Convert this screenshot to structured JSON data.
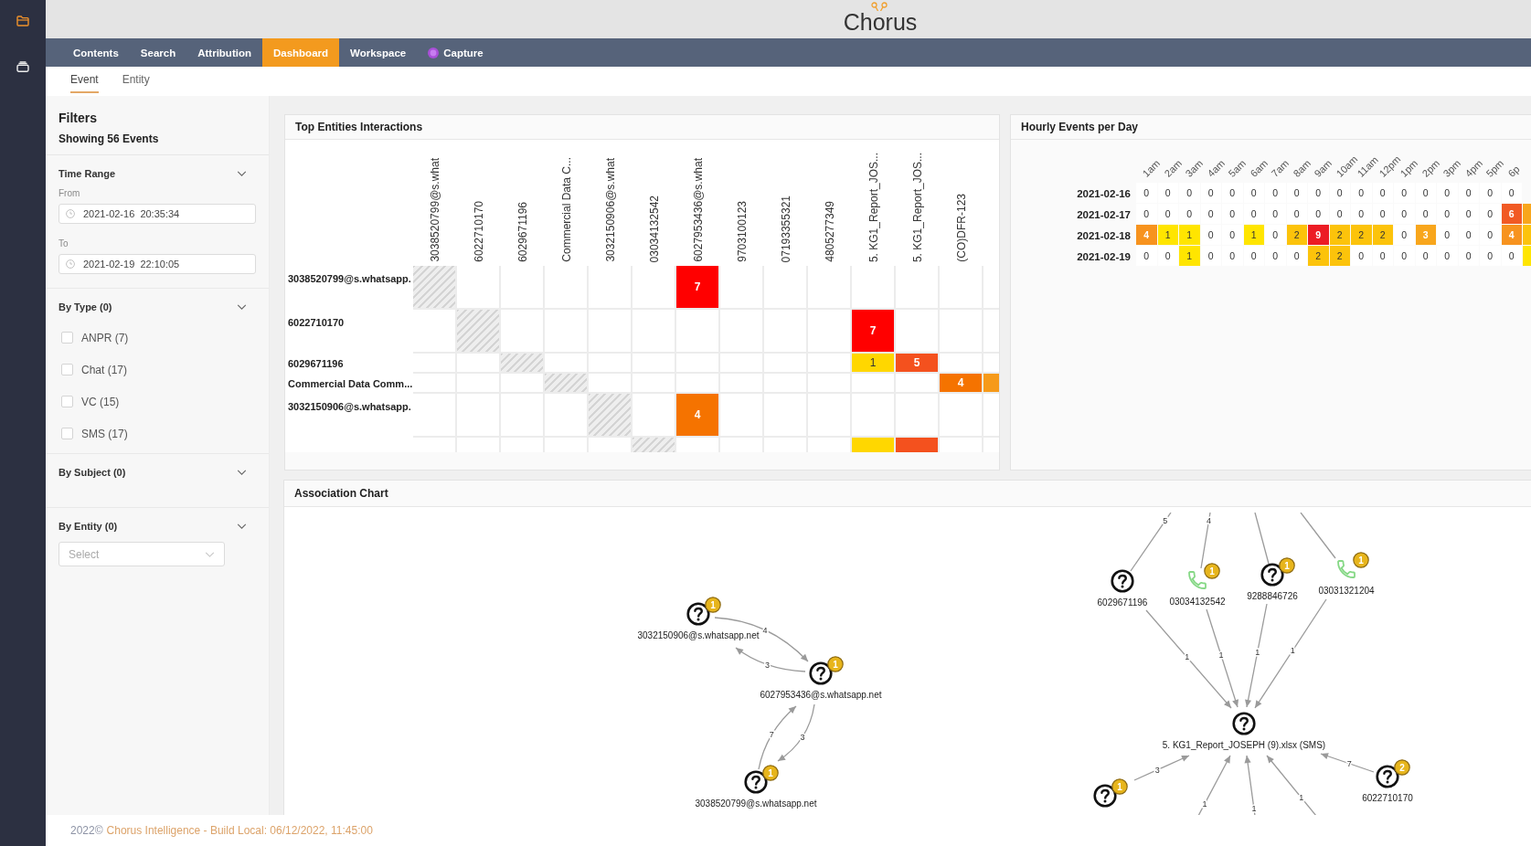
{
  "sidebar": {
    "items": [
      {
        "selected": true
      },
      {
        "selected": false
      }
    ]
  },
  "header": {
    "logo": "Chorus"
  },
  "nav": {
    "items": [
      {
        "label": "Contents",
        "kind": "plain",
        "selected": false
      },
      {
        "label": "Search",
        "kind": "plain",
        "selected": false
      },
      {
        "label": "Attribution",
        "kind": "plain",
        "selected": false
      },
      {
        "label": "Dashboard",
        "kind": "plain",
        "selected": true
      },
      {
        "label": "Workspace",
        "kind": "plain",
        "selected": false
      },
      {
        "label": "Capture",
        "kind": "icon",
        "selected": false
      }
    ]
  },
  "subtabs": [
    {
      "label": "Event",
      "selected": true
    },
    {
      "label": "Entity",
      "selected": false
    }
  ],
  "filters": {
    "title": "Filters",
    "summary": "Showing 56 Events",
    "sections": [
      {
        "kind": "time",
        "title": "Time Range",
        "from_label": "From",
        "from_value": "2021-02-16  20:35:34",
        "to_label": "To",
        "to_value": "2021-02-19  22:10:05"
      },
      {
        "kind": "checklist",
        "title": "By Type (0)",
        "options": [
          {
            "label": "ANPR (7)",
            "checked": false
          },
          {
            "label": "Chat (17)",
            "checked": false
          },
          {
            "label": "VC (15)",
            "checked": false
          },
          {
            "label": "SMS (17)",
            "checked": false
          }
        ]
      },
      {
        "kind": "empty",
        "title": "By Subject (0)"
      },
      {
        "kind": "select",
        "title": "By Entity (0)",
        "placeholder": "Select"
      }
    ]
  },
  "top_entities": {
    "title": "Top Entities Interactions",
    "columns": [
      "3038520799@s.what",
      "6022710170",
      "6029671196",
      "Commercial Data C...",
      "3032150906@s.what",
      "03034132542",
      "6027953436@s.what",
      "9703100123",
      "07193355321",
      "4805277349",
      "5. KG1_Report_JOS...",
      "5. KG1_Report_JOS...",
      "(CO)DFR-123"
    ],
    "rows": [
      {
        "label": "3038520799@s.whatsapp.",
        "kind": "tall",
        "cells": [
          {
            "kind": "self"
          },
          {
            "kind": "blank"
          },
          {
            "kind": "blank"
          },
          {
            "kind": "blank"
          },
          {
            "kind": "blank"
          },
          {
            "kind": "blank"
          },
          {
            "kind": "count",
            "value": "7",
            "color": "#ff0000"
          },
          {
            "kind": "blank"
          },
          {
            "kind": "blank"
          },
          {
            "kind": "blank"
          },
          {
            "kind": "blank"
          },
          {
            "kind": "blank"
          },
          {
            "kind": "blank"
          },
          {
            "kind": "blank"
          }
        ]
      },
      {
        "label": "6022710170",
        "kind": "tall",
        "cells": [
          {
            "kind": "blank"
          },
          {
            "kind": "self"
          },
          {
            "kind": "blank"
          },
          {
            "kind": "blank"
          },
          {
            "kind": "blank"
          },
          {
            "kind": "blank"
          },
          {
            "kind": "blank"
          },
          {
            "kind": "blank"
          },
          {
            "kind": "blank"
          },
          {
            "kind": "blank"
          },
          {
            "kind": "count",
            "value": "7",
            "color": "#ff0000"
          },
          {
            "kind": "blank"
          },
          {
            "kind": "blank"
          },
          {
            "kind": "blank"
          }
        ]
      },
      {
        "label": "6029671196",
        "kind": "short",
        "cells": [
          {
            "kind": "blank"
          },
          {
            "kind": "blank"
          },
          {
            "kind": "self"
          },
          {
            "kind": "blank"
          },
          {
            "kind": "blank"
          },
          {
            "kind": "blank"
          },
          {
            "kind": "blank"
          },
          {
            "kind": "blank"
          },
          {
            "kind": "blank"
          },
          {
            "kind": "blank"
          },
          {
            "kind": "count",
            "value": "1",
            "color": "#ffd700"
          },
          {
            "kind": "count",
            "value": "5",
            "color": "#f4511e"
          },
          {
            "kind": "blank"
          },
          {
            "kind": "blank"
          }
        ]
      },
      {
        "label": "Commercial Data Comm...",
        "kind": "short",
        "cells": [
          {
            "kind": "blank"
          },
          {
            "kind": "blank"
          },
          {
            "kind": "blank"
          },
          {
            "kind": "self"
          },
          {
            "kind": "blank"
          },
          {
            "kind": "blank"
          },
          {
            "kind": "blank"
          },
          {
            "kind": "blank"
          },
          {
            "kind": "blank"
          },
          {
            "kind": "blank"
          },
          {
            "kind": "blank"
          },
          {
            "kind": "blank"
          },
          {
            "kind": "count",
            "value": "4",
            "color": "#f57300"
          },
          {
            "kind": "count",
            "color": "#f69a1a"
          }
        ]
      },
      {
        "label": "3032150906@s.whatsapp.",
        "kind": "tall",
        "cells": [
          {
            "kind": "blank"
          },
          {
            "kind": "blank"
          },
          {
            "kind": "blank"
          },
          {
            "kind": "blank"
          },
          {
            "kind": "self"
          },
          {
            "kind": "blank"
          },
          {
            "kind": "count",
            "value": "4",
            "color": "#f57300"
          },
          {
            "kind": "blank"
          },
          {
            "kind": "blank"
          },
          {
            "kind": "blank"
          },
          {
            "kind": "blank"
          },
          {
            "kind": "blank"
          },
          {
            "kind": "blank"
          },
          {
            "kind": "blank"
          }
        ]
      },
      {
        "kind": "tall",
        "cells": [
          {
            "kind": "blank"
          },
          {
            "kind": "blank"
          },
          {
            "kind": "blank"
          },
          {
            "kind": "blank"
          },
          {
            "kind": "blank"
          },
          {
            "kind": "self"
          },
          {
            "kind": "blank"
          },
          {
            "kind": "blank"
          },
          {
            "kind": "blank"
          },
          {
            "kind": "blank"
          },
          {
            "kind": "count",
            "color": "#ffd700"
          },
          {
            "kind": "count",
            "color": "#f4511e"
          },
          {
            "kind": "blank"
          },
          {
            "kind": "blank"
          }
        ]
      }
    ]
  },
  "hourly_events": {
    "title": "Hourly Events per Day",
    "columns": [
      "1am",
      "2am",
      "3am",
      "4am",
      "5am",
      "6am",
      "7am",
      "8am",
      "9am",
      "10am",
      "11am",
      "12pm",
      "1pm",
      "2pm",
      "3pm",
      "4pm",
      "5pm",
      "6p"
    ],
    "rows": [
      {
        "date": "2021-02-16",
        "cells": [
          {
            "value": "0"
          },
          {
            "value": "0"
          },
          {
            "value": "0"
          },
          {
            "value": "0"
          },
          {
            "value": "0"
          },
          {
            "value": "0"
          },
          {
            "value": "0"
          },
          {
            "value": "0"
          },
          {
            "value": "0"
          },
          {
            "value": "0"
          },
          {
            "value": "0"
          },
          {
            "value": "0"
          },
          {
            "value": "0"
          },
          {
            "value": "0"
          },
          {
            "value": "0"
          },
          {
            "value": "0"
          },
          {
            "value": "0"
          },
          {
            "value": "0"
          }
        ]
      },
      {
        "date": "2021-02-17",
        "cells": [
          {
            "value": "0"
          },
          {
            "value": "0"
          },
          {
            "value": "0"
          },
          {
            "value": "0"
          },
          {
            "value": "0"
          },
          {
            "value": "0"
          },
          {
            "value": "0"
          },
          {
            "value": "0"
          },
          {
            "value": "0"
          },
          {
            "value": "0"
          },
          {
            "value": "0"
          },
          {
            "value": "0"
          },
          {
            "value": "0"
          },
          {
            "value": "0"
          },
          {
            "value": "0"
          },
          {
            "value": "0"
          },
          {
            "value": "0"
          },
          {
            "value": "6",
            "color": "#f15a24"
          },
          {
            "color": "#f8a61c"
          }
        ]
      },
      {
        "date": "2021-02-18",
        "cells": [
          {
            "value": "4",
            "color": "#f7931e"
          },
          {
            "value": "1",
            "color": "#ffe500"
          },
          {
            "value": "1",
            "color": "#ffe500"
          },
          {
            "value": "0"
          },
          {
            "value": "0"
          },
          {
            "value": "1",
            "color": "#ffe500"
          },
          {
            "value": "0"
          },
          {
            "value": "2",
            "color": "#fcc30b"
          },
          {
            "value": "9",
            "color": "#ec1c24"
          },
          {
            "value": "2",
            "color": "#fcc30b"
          },
          {
            "value": "2",
            "color": "#fcc30b"
          },
          {
            "value": "2",
            "color": "#fcc30b"
          },
          {
            "value": "0"
          },
          {
            "value": "3",
            "color": "#f8a61c"
          },
          {
            "value": "0"
          },
          {
            "value": "0"
          },
          {
            "value": "0"
          },
          {
            "value": "4",
            "color": "#f7931e"
          },
          {
            "color": "#fcc30b"
          }
        ]
      },
      {
        "date": "2021-02-19",
        "cells": [
          {
            "value": "0"
          },
          {
            "value": "0"
          },
          {
            "value": "1",
            "color": "#ffe500"
          },
          {
            "value": "0"
          },
          {
            "value": "0"
          },
          {
            "value": "0"
          },
          {
            "value": "0"
          },
          {
            "value": "0"
          },
          {
            "value": "2",
            "color": "#fcc30b"
          },
          {
            "value": "2",
            "color": "#fcc30b"
          },
          {
            "value": "0"
          },
          {
            "value": "0"
          },
          {
            "value": "0"
          },
          {
            "value": "0"
          },
          {
            "value": "0"
          },
          {
            "value": "0"
          },
          {
            "value": "0"
          },
          {
            "value": "0"
          },
          {
            "color": "#ffe500"
          }
        ]
      }
    ]
  },
  "association_chart": {
    "title": "Association Chart",
    "nodes": [
      {
        "kind": "unknown",
        "label": "3032150906@s.whatsapp.net",
        "badge": "1"
      },
      {
        "kind": "unknown",
        "label": "6027953436@s.whatsapp.net",
        "badge": "1"
      },
      {
        "kind": "unknown",
        "label": "3038520799@s.whatsapp.net",
        "badge": "1"
      },
      {
        "kind": "unknown",
        "label": "6029671196"
      },
      {
        "kind": "phone",
        "label": "03034132542",
        "badge": "1"
      },
      {
        "kind": "unknown",
        "label": "9288846726",
        "badge": "1"
      },
      {
        "kind": "phone",
        "label": "03031321204",
        "badge": "1"
      },
      {
        "kind": "unknown",
        "label": "5. KG1_Report_JOSEPH (9).xlsx (SMS)"
      },
      {
        "kind": "unknown",
        "badge": "1"
      },
      {
        "kind": "unknown",
        "label": "6022710170",
        "badge": "2"
      }
    ],
    "edges": [
      {
        "kind": "arrow",
        "label": "4"
      },
      {
        "kind": "arrow",
        "label": "3"
      },
      {
        "kind": "arrow",
        "label": "7"
      },
      {
        "kind": "arrow",
        "label": "3"
      },
      {
        "kind": "line",
        "label": "5"
      },
      {
        "kind": "line",
        "label": "4"
      },
      {
        "kind": "line"
      },
      {
        "kind": "line"
      },
      {
        "kind": "arrow",
        "label": "1"
      },
      {
        "kind": "arrow",
        "label": "1"
      },
      {
        "kind": "arrow",
        "label": "1"
      },
      {
        "kind": "arrow",
        "label": "1"
      },
      {
        "kind": "arrow",
        "label": "3"
      },
      {
        "kind": "arrow",
        "label": "7"
      },
      {
        "kind": "arrow",
        "label": "1"
      },
      {
        "kind": "arrow",
        "label": "1"
      },
      {
        "kind": "arrow",
        "label": "1"
      }
    ]
  },
  "footer": {
    "copyright": "2022©",
    "build": "Chorus Intelligence - Build Local: 06/12/2022, 11:45:00"
  }
}
